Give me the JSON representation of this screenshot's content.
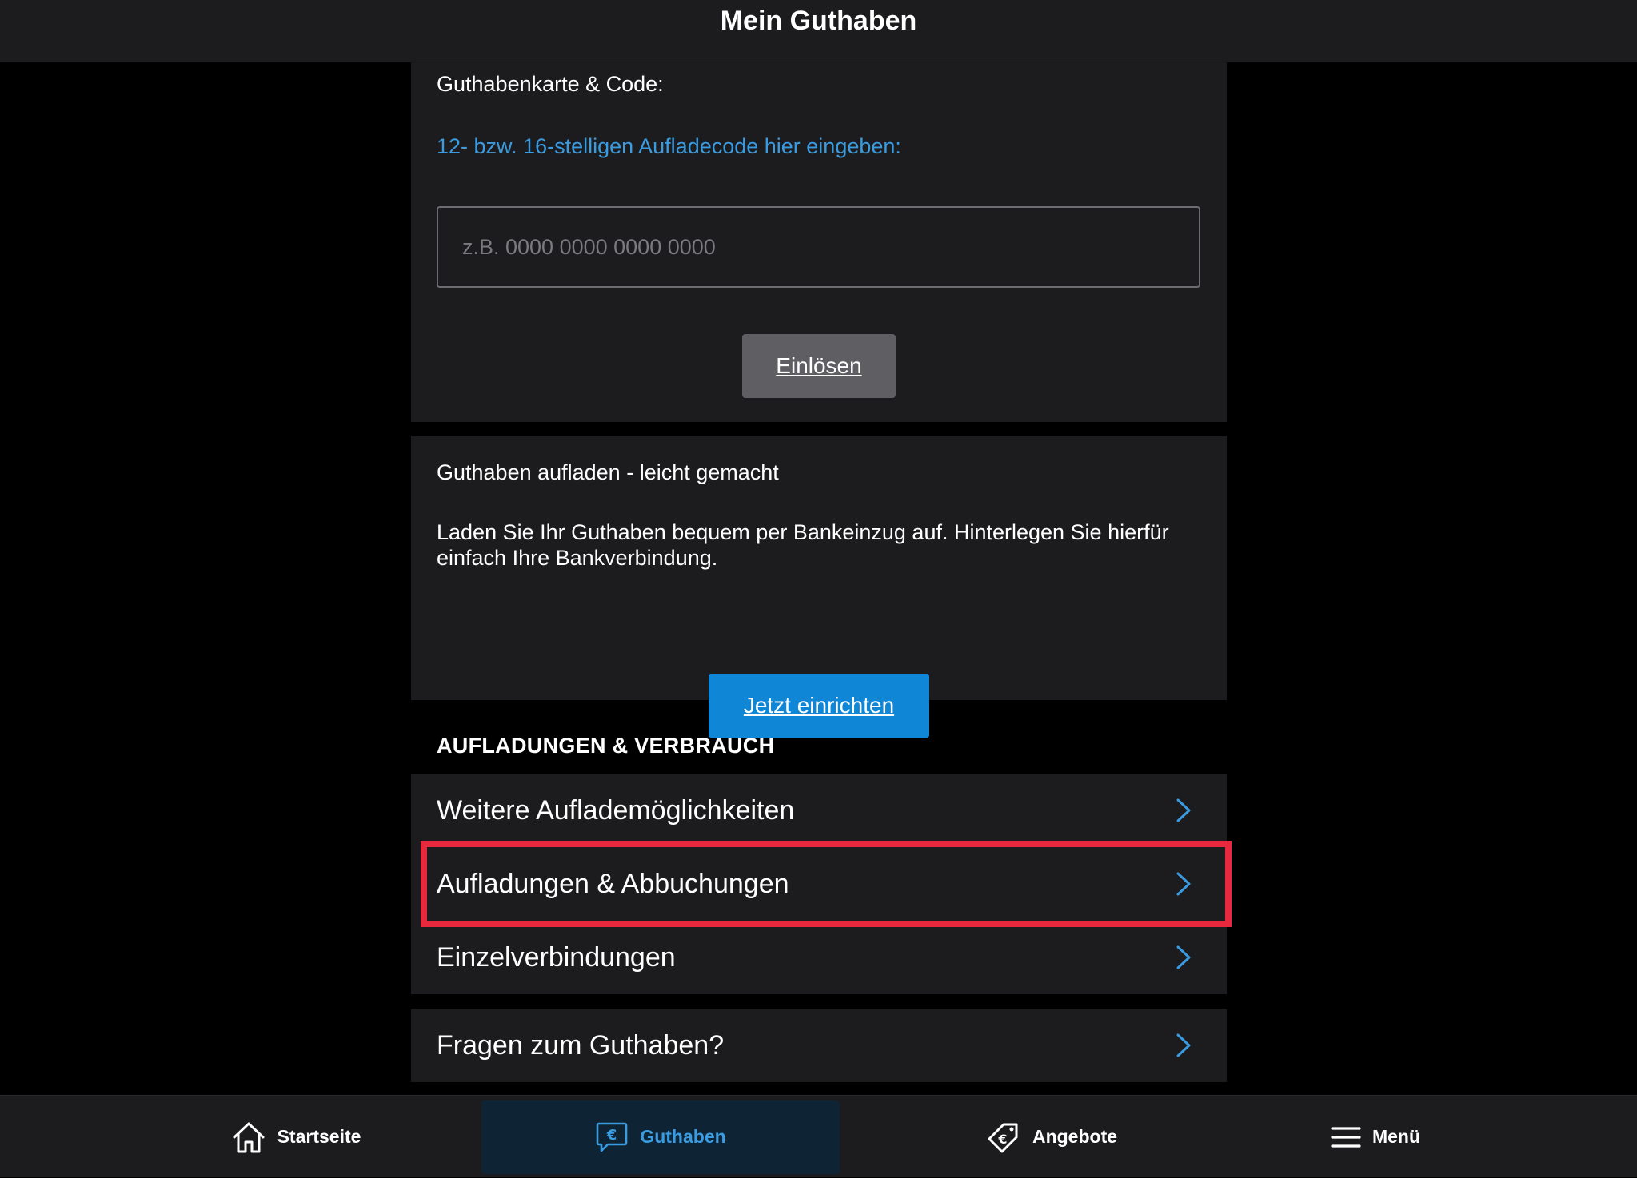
{
  "header": {
    "title": "Mein Guthaben"
  },
  "code_card": {
    "heading": "Guthabenkarte & Code:",
    "hint": "12- bzw. 16-stelligen Aufladecode hier eingeben:",
    "input_value": "",
    "input_placeholder": "z.B. 0000 0000 0000 0000",
    "redeem_label": "Einlösen"
  },
  "topup_card": {
    "heading": "Guthaben aufladen - leicht gemacht",
    "description": "Laden Sie Ihr Guthaben bequem per Bankeinzug auf. Hinterlegen Sie hierfür einfach Ihre Bankverbindung.",
    "setup_label": "Jetzt einrichten"
  },
  "section": {
    "title": "AUFLADUNGEN & VERBRAUCH"
  },
  "list": {
    "items": [
      {
        "label": "Weitere Auflademöglichkeiten",
        "icon": "chevron-right-icon"
      },
      {
        "label": "Aufladungen & Abbuchungen",
        "icon": "chevron-right-icon",
        "highlighted": true
      },
      {
        "label": "Einzelverbindungen",
        "icon": "chevron-right-icon"
      },
      {
        "label": "Fragen zum Guthaben?",
        "icon": "chevron-right-icon"
      }
    ]
  },
  "tabs": [
    {
      "label": "Startseite",
      "icon": "home-icon",
      "active": false
    },
    {
      "label": "Guthaben",
      "icon": "euro-chat-icon",
      "active": true
    },
    {
      "label": "Angebote",
      "icon": "euro-tag-icon",
      "active": false
    },
    {
      "label": "Menü",
      "icon": "hamburger-menu-icon",
      "active": false
    }
  ],
  "colors": {
    "accent": "#3b9be0",
    "button_primary": "#0f86d6",
    "button_secondary": "#5f5f63",
    "highlight_border": "#e8283c",
    "surface": "#1c1c1e",
    "background": "#000000"
  }
}
